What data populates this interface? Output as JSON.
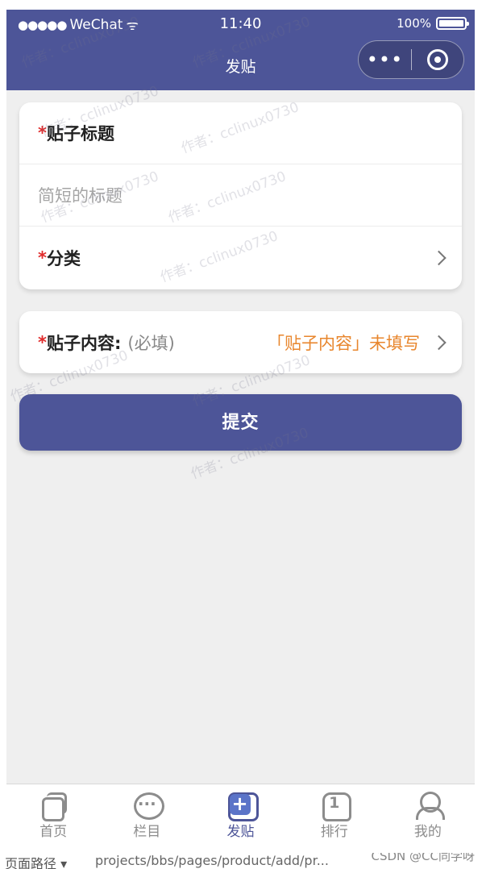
{
  "statusbar": {
    "signal": "●●●●●",
    "carrier": "WeChat",
    "wifi": "ᯤ",
    "time": "11:40",
    "battery": "100%"
  },
  "navbar": {
    "title": "发贴",
    "more": "•••"
  },
  "form": {
    "required_mark": "*",
    "title_label": "贴子标题",
    "title_placeholder": "简短的标题",
    "category_label": "分类",
    "content_label": "贴子内容:",
    "content_hint": "(必填)",
    "content_warning": "「贴子内容」未填写",
    "submit_label": "提交"
  },
  "tabbar": {
    "items": [
      {
        "label": "首页",
        "icon": "home-icon"
      },
      {
        "label": "栏目",
        "icon": "column-icon"
      },
      {
        "label": "发贴",
        "icon": "post-icon"
      },
      {
        "label": "排行",
        "icon": "rank-icon"
      },
      {
        "label": "我的",
        "icon": "profile-icon"
      }
    ],
    "active": "发贴"
  },
  "devtools": {
    "path_label": "页面路径 ▾",
    "path_value": "projects/bbs/pages/product/add/pr...",
    "credit": "CSDN @CC同学呀"
  },
  "watermark": "作者：cclinux0730",
  "colors": {
    "primary": "#4d5598",
    "required": "#e02b2b",
    "warning": "#e8862d",
    "background": "#efefef"
  }
}
